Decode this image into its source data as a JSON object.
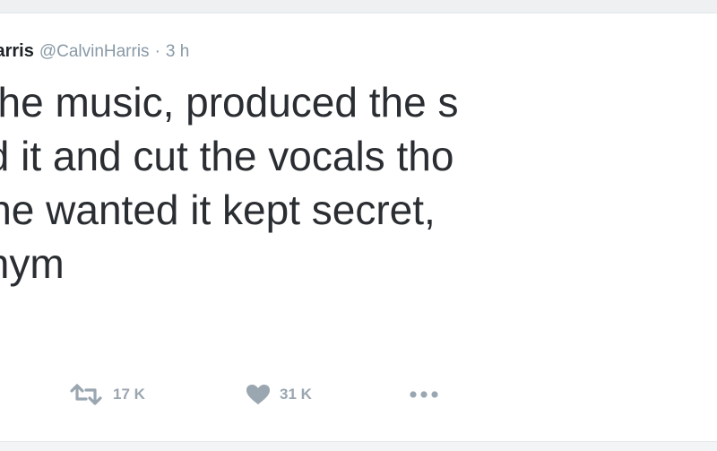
{
  "tweet": {
    "display_name": "Harris",
    "handle": "@CalvinHarris",
    "separator": "·",
    "time": "3 h",
    "lines": [
      "ote the music, produced the s",
      "nged it and cut the vocals tho",
      "lly she wanted it kept secret,",
      "udonym"
    ]
  },
  "actions": {
    "retweet_count": "17 K",
    "like_count": "31 K"
  },
  "colors": {
    "text": "#2a2d31",
    "muted": "#8899a6",
    "icon": "#9aa6b0",
    "background": "#ffffff"
  },
  "icons": {
    "retweet": "retweet-icon",
    "like": "heart-icon",
    "more": "more-icon"
  }
}
